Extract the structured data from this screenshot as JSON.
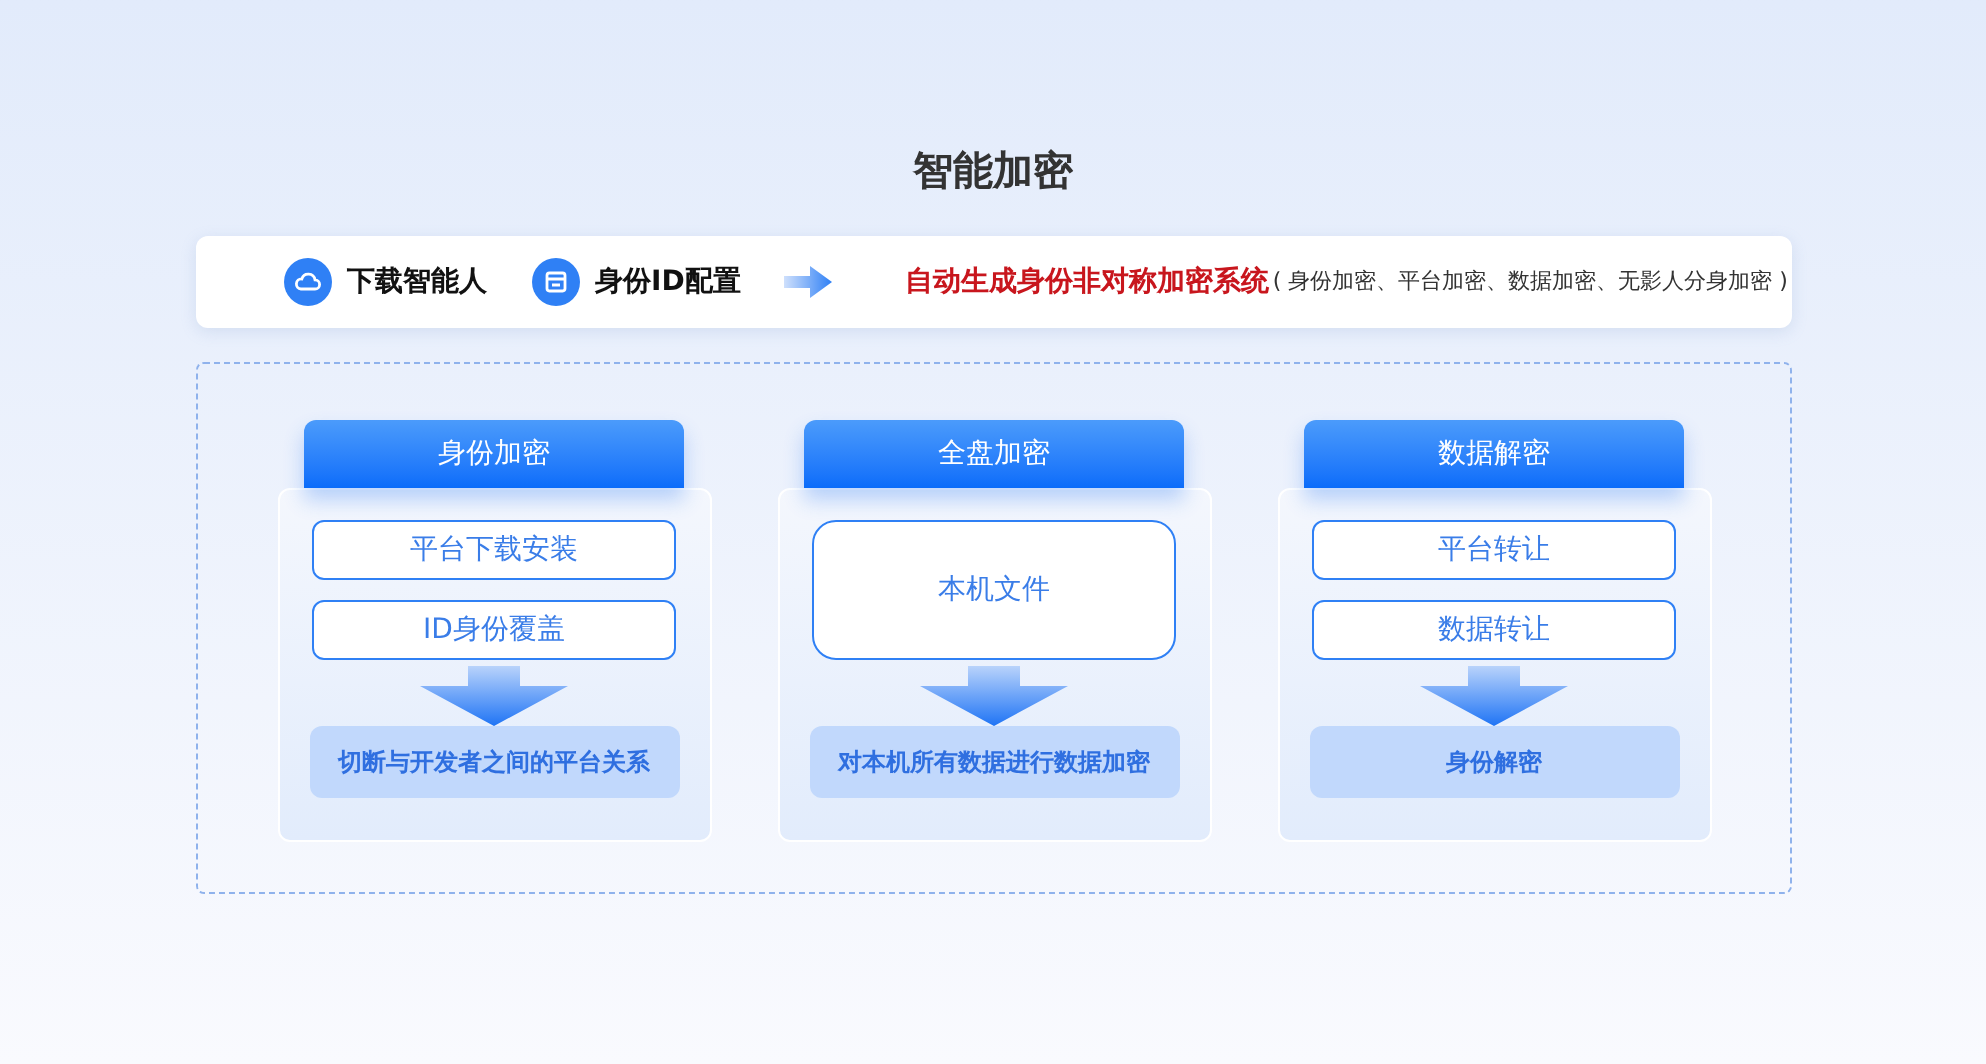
{
  "title": "智能加密",
  "flow": {
    "steps": [
      {
        "label": "下载智能人"
      },
      {
        "label": "身份ID配置"
      }
    ],
    "result": "自动生成身份非对称加密系统",
    "note": "( 身份加密、平台加密、数据加密、无影人分身加密 )"
  },
  "columns": [
    {
      "title": "身份加密",
      "steps": [
        "平台下载安装",
        "ID身份覆盖"
      ],
      "outcome": "切断与开发者之间的平台关系"
    },
    {
      "title": "全盘加密",
      "steps": [
        "本机文件"
      ],
      "outcome": "对本机所有数据进行数据加密"
    },
    {
      "title": "数据解密",
      "steps": [
        "平台转让",
        "数据转让"
      ],
      "outcome": "身份解密"
    }
  ]
}
